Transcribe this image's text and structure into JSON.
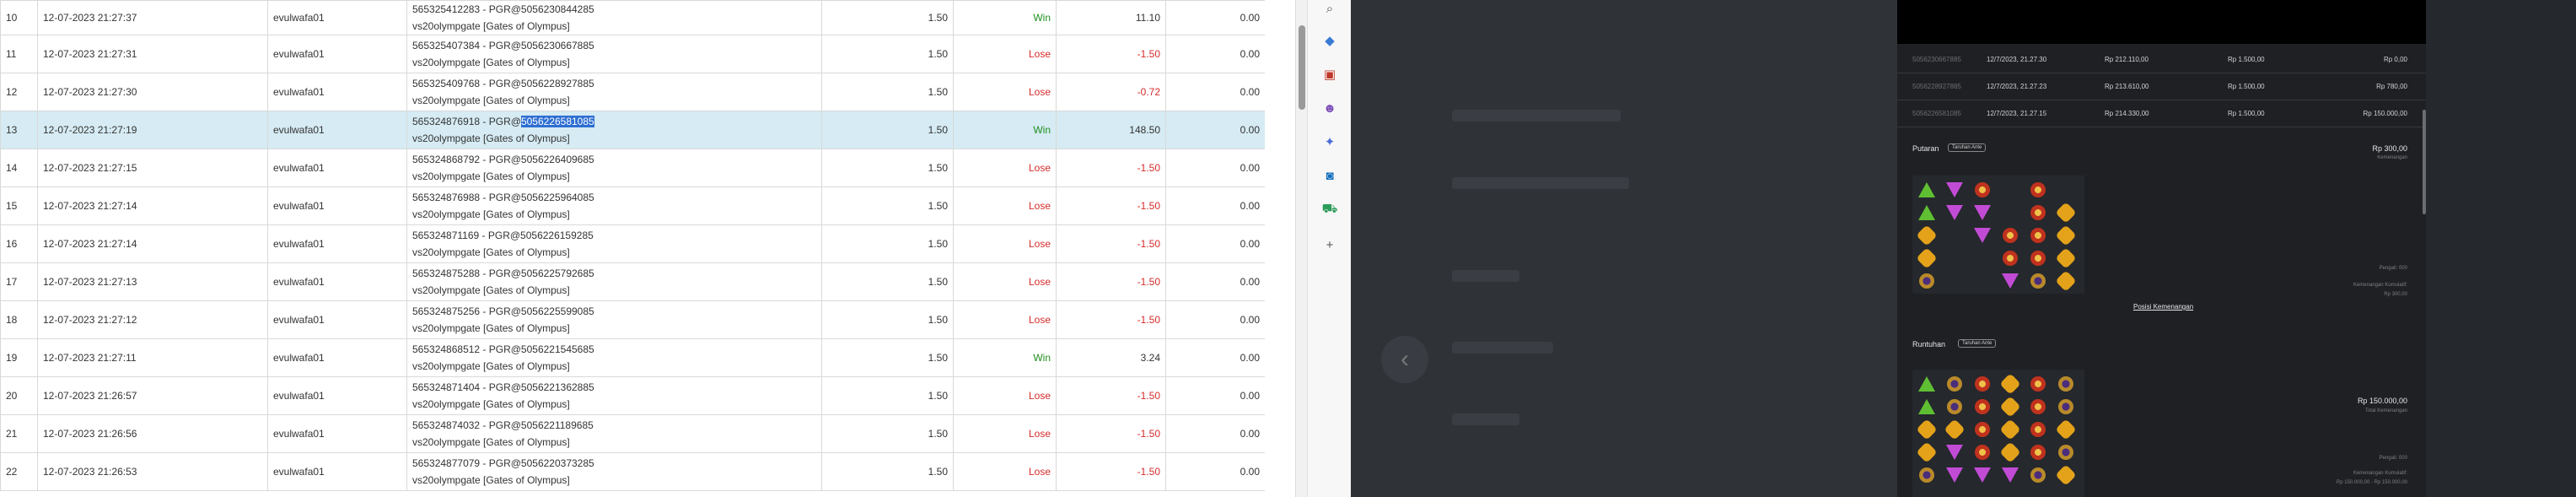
{
  "bets": [
    {
      "no": "10",
      "datetime": "12-07-2023 21:27:37",
      "user": "evulwafa01",
      "tx_id": "565325412283 - PGR@5056230844285",
      "game": "vs20olympgate [Gates of Olympus]",
      "bet": "1.50",
      "result": "Win",
      "amount": "11.10",
      "extra": "0.00"
    },
    {
      "no": "11",
      "datetime": "12-07-2023 21:27:31",
      "user": "evulwafa01",
      "tx_id": "565325407384 - PGR@5056230667885",
      "game": "vs20olympgate [Gates of Olympus]",
      "bet": "1.50",
      "result": "Lose",
      "amount": "-1.50",
      "extra": "0.00"
    },
    {
      "no": "12",
      "datetime": "12-07-2023 21:27:30",
      "user": "evulwafa01",
      "tx_id": "565325409768 - PGR@5056228927885",
      "game": "vs20olympgate [Gates of Olympus]",
      "bet": "1.50",
      "result": "Lose",
      "amount": "-0.72",
      "extra": "0.00"
    },
    {
      "no": "13",
      "datetime": "12-07-2023 21:27:19",
      "user": "evulwafa01",
      "tx_id_prefix": "565324876918 - PGR@",
      "tx_id_highlight": "5056226581085",
      "game": "vs20olympgate [Gates of Olympus]",
      "bet": "1.50",
      "result": "Win",
      "amount": "148.50",
      "extra": "0.00"
    },
    {
      "no": "14",
      "datetime": "12-07-2023 21:27:15",
      "user": "evulwafa01",
      "tx_id": "565324868792 - PGR@5056226409685",
      "game": "vs20olympgate [Gates of Olympus]",
      "bet": "1.50",
      "result": "Lose",
      "amount": "-1.50",
      "extra": "0.00"
    },
    {
      "no": "15",
      "datetime": "12-07-2023 21:27:14",
      "user": "evulwafa01",
      "tx_id": "565324876988 - PGR@5056225964085",
      "game": "vs20olympgate [Gates of Olympus]",
      "bet": "1.50",
      "result": "Lose",
      "amount": "-1.50",
      "extra": "0.00"
    },
    {
      "no": "16",
      "datetime": "12-07-2023 21:27:14",
      "user": "evulwafa01",
      "tx_id": "565324871169 - PGR@5056226159285",
      "game": "vs20olympgate [Gates of Olympus]",
      "bet": "1.50",
      "result": "Lose",
      "amount": "-1.50",
      "extra": "0.00"
    },
    {
      "no": "17",
      "datetime": "12-07-2023 21:27:13",
      "user": "evulwafa01",
      "tx_id": "565324875288 - PGR@5056225792685",
      "game": "vs20olympgate [Gates of Olympus]",
      "bet": "1.50",
      "result": "Lose",
      "amount": "-1.50",
      "extra": "0.00"
    },
    {
      "no": "18",
      "datetime": "12-07-2023 21:27:12",
      "user": "evulwafa01",
      "tx_id": "565324875256 - PGR@5056225599085",
      "game": "vs20olympgate [Gates of Olympus]",
      "bet": "1.50",
      "result": "Lose",
      "amount": "-1.50",
      "extra": "0.00"
    },
    {
      "no": "19",
      "datetime": "12-07-2023 21:27:11",
      "user": "evulwafa01",
      "tx_id": "565324868512 - PGR@5056221545685",
      "game": "vs20olympgate [Gates of Olympus]",
      "bet": "1.50",
      "result": "Win",
      "amount": "3.24",
      "extra": "0.00"
    },
    {
      "no": "20",
      "datetime": "12-07-2023 21:26:57",
      "user": "evulwafa01",
      "tx_id": "565324871404 - PGR@5056221362885",
      "game": "vs20olympgate [Gates of Olympus]",
      "bet": "1.50",
      "result": "Lose",
      "amount": "-1.50",
      "extra": "0.00"
    },
    {
      "no": "21",
      "datetime": "12-07-2023 21:26:56",
      "user": "evulwafa01",
      "tx_id": "565324874032 - PGR@5056221189685",
      "game": "vs20olympgate [Gates of Olympus]",
      "bet": "1.50",
      "result": "Lose",
      "amount": "-1.50",
      "extra": "0.00"
    },
    {
      "no": "22",
      "datetime": "12-07-2023 21:26:53",
      "user": "evulwafa01",
      "tx_id": "565324877079 - PGR@5056220373285",
      "game": "vs20olympgate [Gates of Olympus]",
      "bet": "1.50",
      "result": "Lose",
      "amount": "-1.50",
      "extra": "0.00"
    }
  ],
  "browser_sidebar": {
    "icons": [
      "search-icon",
      "tag-icon",
      "briefcase-icon",
      "people-icon",
      "copilot-icon",
      "outlook-icon",
      "shopping-icon",
      "add-icon"
    ]
  },
  "game_history": {
    "rows": [
      {
        "id": "5056230667885",
        "date": "12/7/2023, 21.27.30",
        "balance": "Rp 212.110,00",
        "bet": "Rp 1.500,00",
        "win": "Rp 0,00"
      },
      {
        "id": "5056228927885",
        "date": "12/7/2023, 21.27.23",
        "balance": "Rp 213.610,00",
        "bet": "Rp 1.500,00",
        "win": "Rp 780,00"
      },
      {
        "id": "5056226581085",
        "date": "12/7/2023, 21.27.15",
        "balance": "Rp 214.330,00",
        "bet": "Rp 1.500,00",
        "win": "Rp 150.000,00"
      }
    ],
    "spin": {
      "title": "Putaran",
      "badge": "Taruhan Ante",
      "amount": "Rp 300,00",
      "sub": "Kemenangan",
      "note1": "Pengali: 000",
      "note2": "Kemenangan Kumulatif:",
      "note3": "Rp 300,00"
    },
    "link": "Posisi Kemenangan",
    "tumble": {
      "title": "Runtuhan",
      "badge": "Taruhan Ante",
      "amount": "Rp 150.000,00",
      "sub": "Total Kemenangan",
      "note1": "Pengali: 000",
      "note2": "Kemenangan Kumulatif:",
      "note3": "Rp 150.000,00 - Rp 150.000,00"
    }
  },
  "colors": {
    "win": "#1f8f1f",
    "lose": "#d62b2b",
    "selected_row": "#d6ebf3",
    "highlight": "#2e6fd2"
  }
}
